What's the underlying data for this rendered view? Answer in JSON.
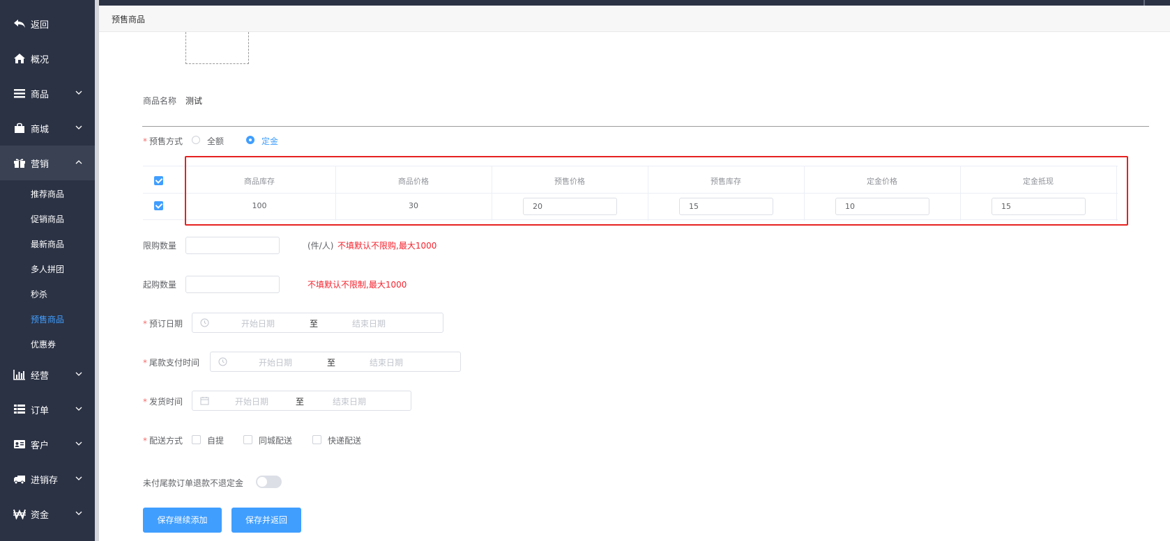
{
  "sidebar": {
    "back": "返回",
    "overview": "概况",
    "goods": "商品",
    "mall": "商城",
    "marketing": "营销",
    "sub_items": [
      "推荐商品",
      "促销商品",
      "最新商品",
      "多人拼团",
      "秒杀",
      "预售商品",
      "优惠券"
    ],
    "operation": "经营",
    "orders": "订单",
    "customers": "客户",
    "inventory": "进销存",
    "funds": "资金"
  },
  "breadcrumb": "预售商品",
  "form": {
    "name_label": "商品名称",
    "name_value": "测试",
    "presale_label": "预售方式",
    "presale_options": [
      "全额",
      "定金"
    ],
    "presale_selected": "定金",
    "table": {
      "headers": [
        "商品库存",
        "商品价格",
        "预售价格",
        "预售库存",
        "定金价格",
        "定金抵现"
      ],
      "row": {
        "stock": "100",
        "price": "30",
        "presale_price": "20",
        "presale_stock": "15",
        "deposit_price": "10",
        "deposit_offset": "15"
      }
    },
    "limit_label": "限购数量",
    "limit_unit": "(件/人)",
    "limit_hint": "不填默认不限购,最大1000",
    "min_label": "起购数量",
    "min_hint": "不填默认不限制,最大1000",
    "booking_label": "预订日期",
    "final_pay_label": "尾款支付时间",
    "ship_label": "发货时间",
    "start_placeholder": "开始日期",
    "range_sep": "至",
    "end_placeholder": "结束日期",
    "delivery_label": "配送方式",
    "delivery_options": [
      "自提",
      "同城配送",
      "快递配送"
    ],
    "refund_label": "未付尾款订单退款不退定金",
    "btn_save_continue": "保存继续添加",
    "btn_save_return": "保存并返回"
  },
  "colors": {
    "sidebar_bg": "#2b3244",
    "accent": "#409eff",
    "danger": "#f5222d"
  }
}
